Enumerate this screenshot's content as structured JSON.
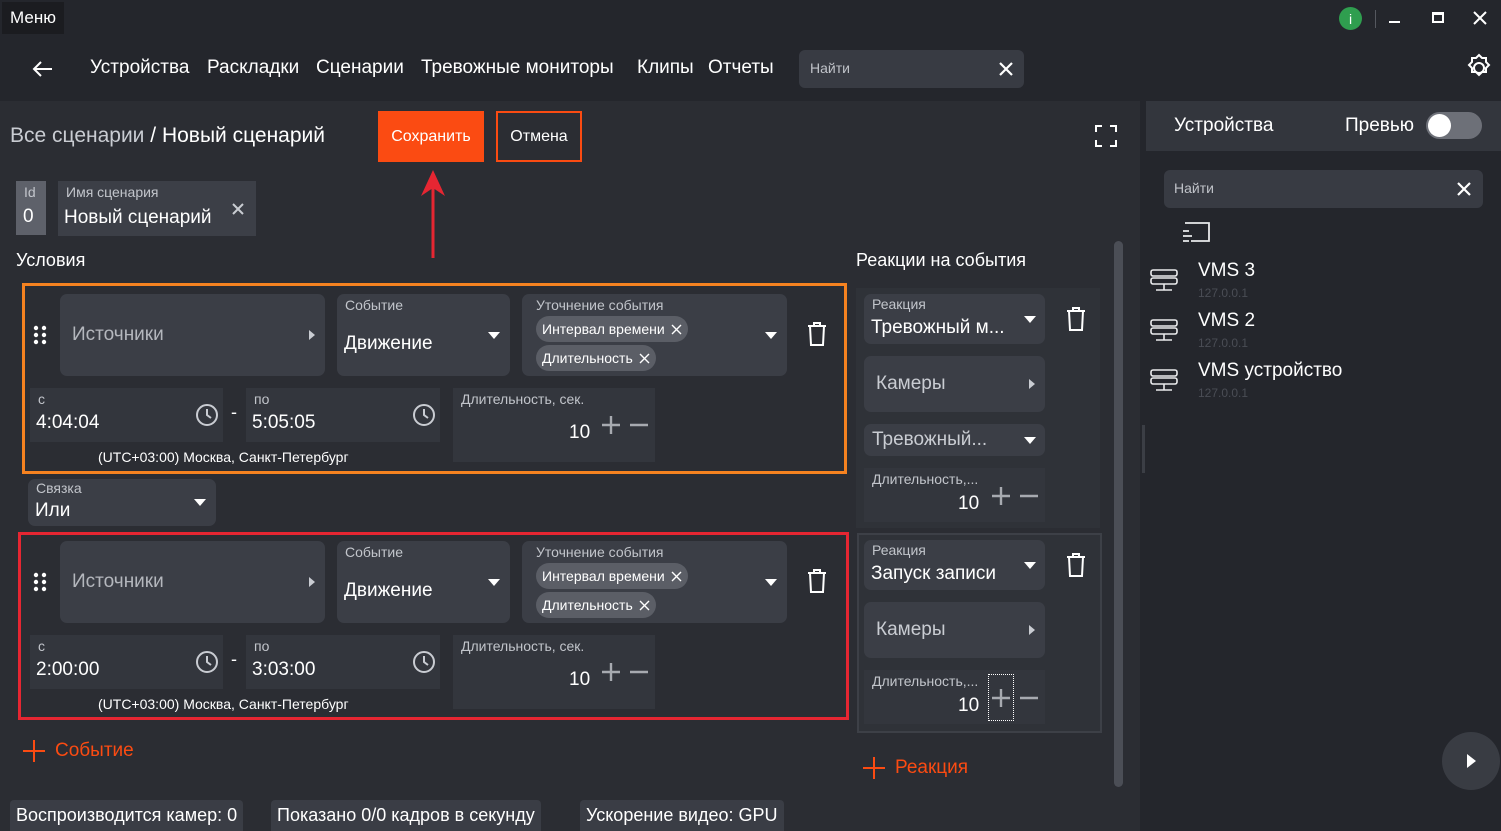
{
  "titlebar": {
    "menu_label": "Меню",
    "info_glyph": "i"
  },
  "nav": {
    "items": [
      "Устройства",
      "Раскладки",
      "Сценарии",
      "Тревожные мониторы",
      "Клипы",
      "Отчеты"
    ],
    "search_placeholder": "Найти"
  },
  "header": {
    "crumb_all": "Все сценарии",
    "crumb_sep": " / ",
    "crumb_current": "Новый сценарий",
    "save_label": "Сохранить",
    "cancel_label": "Отмена"
  },
  "scenario": {
    "id_label": "Id",
    "id_value": "0",
    "name_label": "Имя сценария",
    "name_value": "Новый сценарий"
  },
  "conditions": {
    "title": "Условия",
    "sources_label": "Источники",
    "event_label": "Событие",
    "event_value": "Движение",
    "refine_label": "Уточнение события",
    "chip_interval": "Интервал времени",
    "chip_duration": "Длительность",
    "from_label": "с",
    "to_label": "по",
    "duration_label": "Длительность, сек.",
    "timezone": "(UTC+03:00) Москва, Санкт-Петербург",
    "items": [
      {
        "from": "4:04:04",
        "to": "5:05:05",
        "duration": "10"
      },
      {
        "from": "2:00:00",
        "to": "3:03:00",
        "duration": "10"
      }
    ],
    "link_label": "Связка",
    "link_value": "Или",
    "add_event": "Событие",
    "time_dash": "-"
  },
  "reactions": {
    "title": "Реакции на события",
    "reaction_label": "Реакция",
    "cameras_label": "Камеры",
    "duration_label": "Длительность,...",
    "card1": {
      "value": "Тревожный м...",
      "monitor": "Тревожный...",
      "duration": "10"
    },
    "card2": {
      "value": "Запуск записи",
      "duration": "10"
    },
    "add_reaction": "Реакция"
  },
  "status": {
    "cameras": "Воспроизводится камер: 0",
    "fps": "Показано 0/0 кадров в секунду",
    "accel": "Ускорение видео: GPU"
  },
  "right_panel": {
    "tab_devices": "Устройства",
    "preview_label": "Превью",
    "preview_on": false,
    "search_placeholder": "Найти",
    "devices": [
      {
        "name": "VMS 3",
        "ip": "127.0.0.1"
      },
      {
        "name": "VMS 2",
        "ip": "127.0.0.1"
      },
      {
        "name": "VMS устройство",
        "ip": "127.0.0.1"
      }
    ]
  },
  "colors": {
    "accent": "#fb4b12",
    "highlight_orange": "#f58220",
    "highlight_red": "#e62632"
  }
}
